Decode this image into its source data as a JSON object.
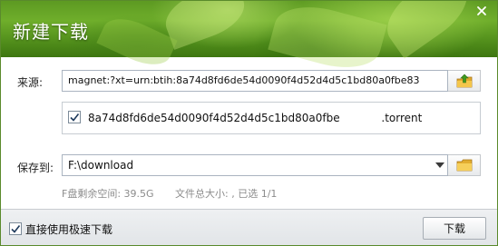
{
  "window": {
    "title": "新建下载",
    "close_icon": "close-icon",
    "theme_color": "#5d9a22"
  },
  "source": {
    "label": "来源:",
    "value": "magnet:?xt=urn:btih:8a74d8fd6de54d0090f4d52d4d5c1bd80a0fbe83",
    "icon": "upload-torrent-icon"
  },
  "files": [
    {
      "checked": true,
      "name": "8a74d8fd6de54d0090f4d52d4d5c1bd80a0fbe            .torrent"
    }
  ],
  "save": {
    "label": "保存到:",
    "path": "F:\\download",
    "dropdown_icon": "chevron-down-icon",
    "folder_icon": "folder-icon"
  },
  "info": {
    "disk_free": "F盘剩余空间: 39.5G",
    "size_selected": "文件总大小: , 已选 1/1"
  },
  "footer": {
    "fast_download_checked": true,
    "fast_download_label": "直接使用极速下载",
    "download_button": "下载"
  }
}
